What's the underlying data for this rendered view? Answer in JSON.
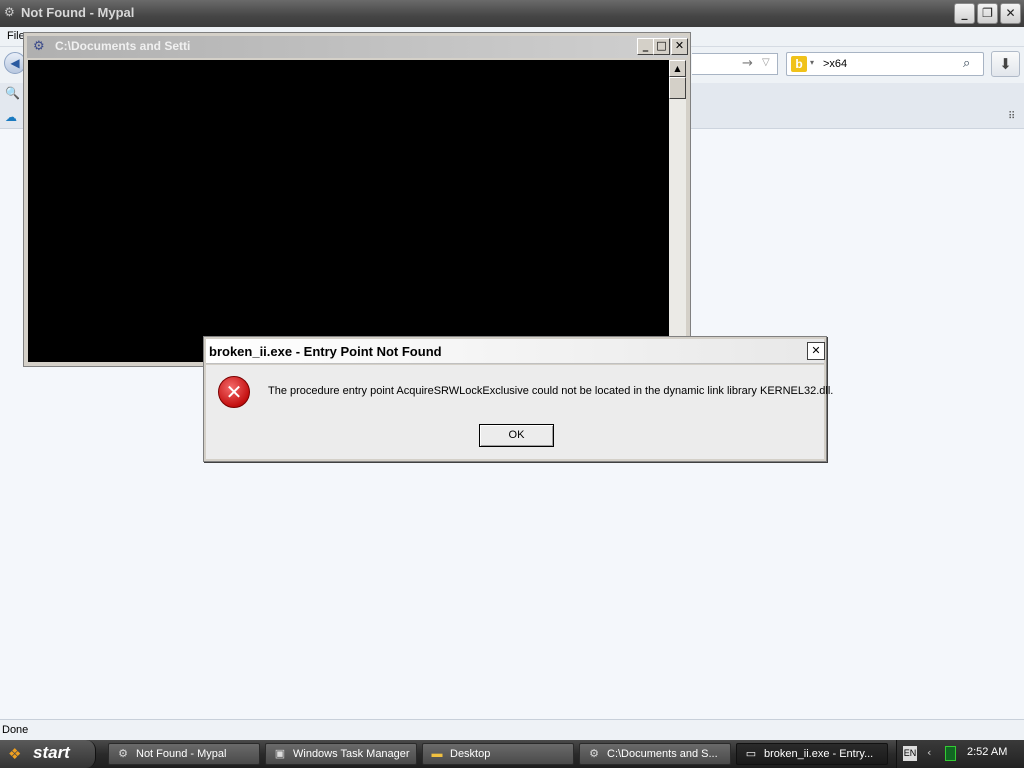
{
  "browser": {
    "title": "Not Found - Mypal",
    "menu": {
      "file": "File"
    },
    "search": {
      "value": ">x64",
      "engine_icon": "bing-icon"
    },
    "status": "Done",
    "controls": {
      "minimize": "_",
      "restore": "❐",
      "close": "✕"
    }
  },
  "console": {
    "title": "C:\\Documents and Setti",
    "controls": {
      "minimize": "_",
      "maximize": "□",
      "close": "✕"
    }
  },
  "dialog": {
    "title": "broken_ii.exe - Entry Point Not Found",
    "message": "The procedure entry point AcquireSRWLockExclusive could not be located in the dynamic link library KERNEL32.dll.",
    "ok_label": "OK",
    "close": "✕",
    "icon": "error-icon"
  },
  "taskbar": {
    "start_label": "start",
    "tasks": [
      {
        "label": "Not Found - Mypal",
        "icon": "mypal-icon"
      },
      {
        "label": "Windows Task Manager",
        "icon": "task-manager-icon"
      },
      {
        "label": "Desktop",
        "icon": "folder-icon"
      },
      {
        "label": "C:\\Documents and S...",
        "icon": "console-icon"
      },
      {
        "label": "broken_ii.exe - Entry...",
        "icon": "window-icon"
      }
    ],
    "tray": {
      "language": "EN",
      "clock": "2:52 AM"
    }
  },
  "colors": {
    "taskbar": "#2a2a2a",
    "error_red": "#c41010",
    "console_bg": "#000000",
    "page_bg": "#f4f7fb"
  }
}
